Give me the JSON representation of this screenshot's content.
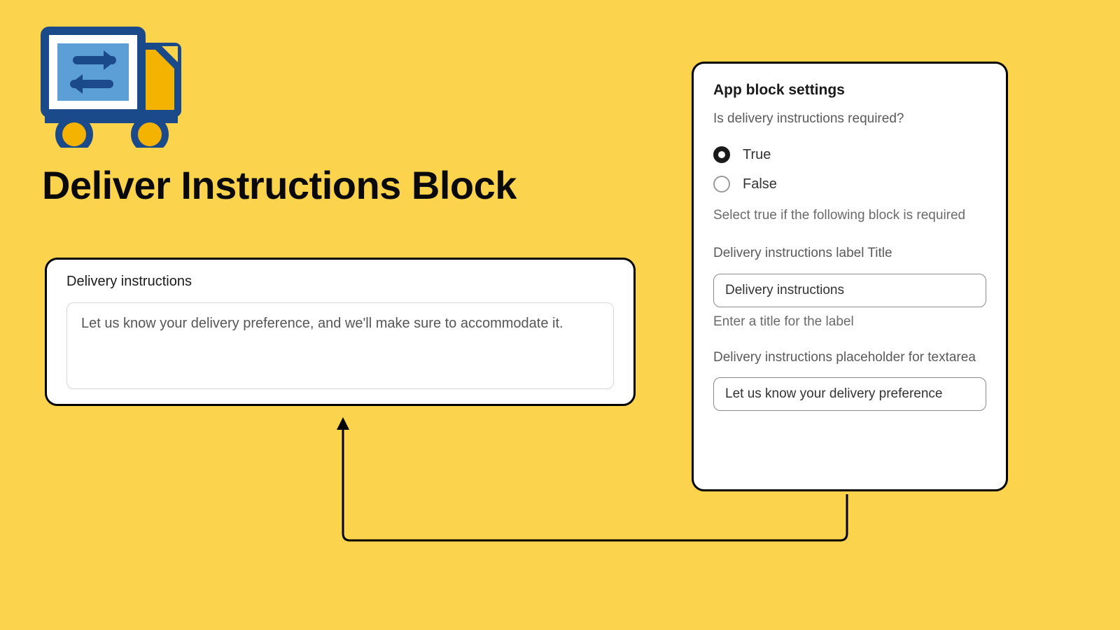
{
  "header": {
    "title": "Deliver Instructions Block"
  },
  "preview": {
    "label": "Delivery instructions",
    "placeholder": "Let us know your delivery preference, and we'll make sure to accommodate it."
  },
  "settings": {
    "title": "App block settings",
    "question": "Is delivery instructions required?",
    "options": {
      "true_label": "True",
      "false_label": "False"
    },
    "required_help": "Select true if the following block is required",
    "label_field": {
      "label": "Delivery instructions label Title",
      "value": "Delivery instructions",
      "help": "Enter a title for the label"
    },
    "placeholder_field": {
      "label": "Delivery instructions placeholder for textarea",
      "value": "Let us know your delivery preference"
    }
  },
  "colors": {
    "background": "#fbd34d",
    "truck_blue": "#1b4a8b",
    "truck_light_blue": "#5c9fd6",
    "truck_yellow": "#f5b301"
  }
}
